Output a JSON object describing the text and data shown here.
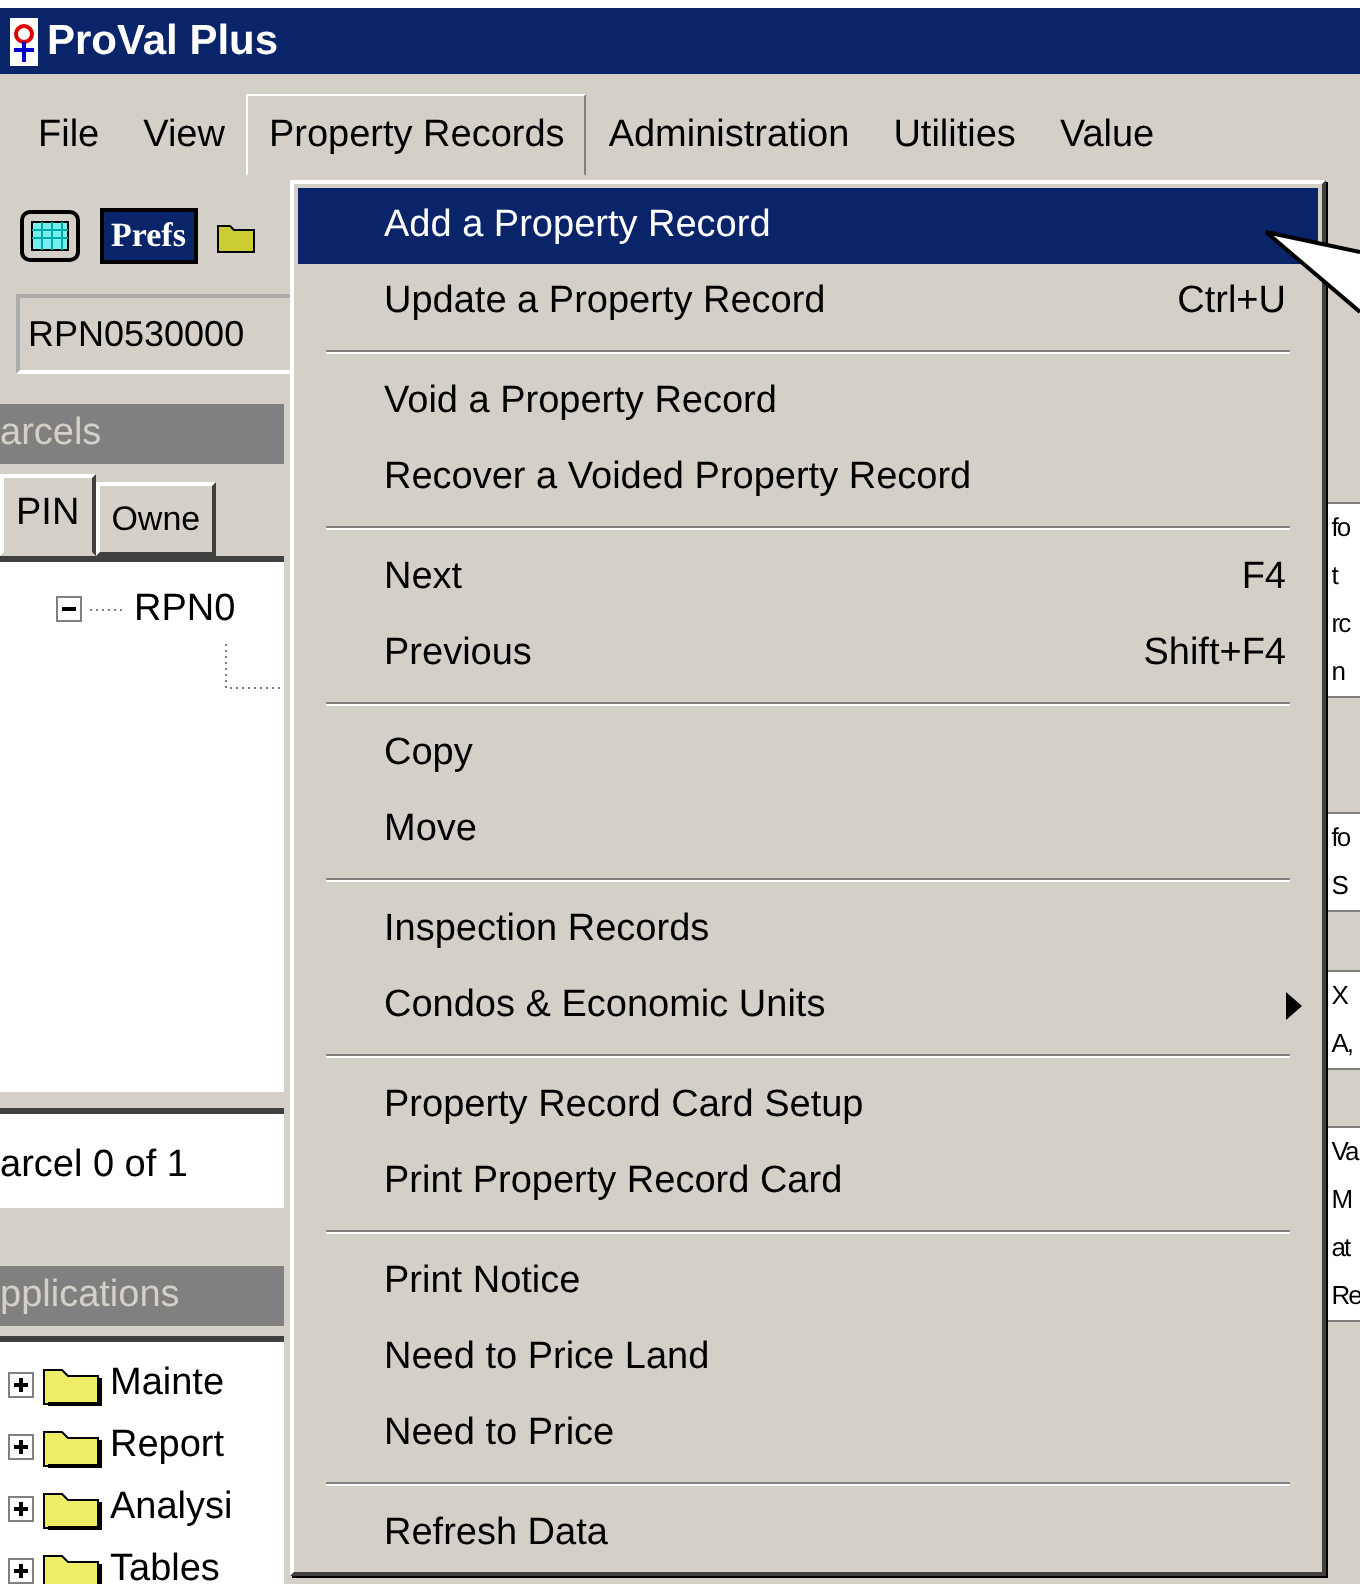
{
  "window": {
    "title": "ProVal Plus"
  },
  "menu_bar": [
    {
      "label": "File",
      "selected": false
    },
    {
      "label": "View",
      "selected": false
    },
    {
      "label": "Property Records",
      "selected": true
    },
    {
      "label": "Administration",
      "selected": false
    },
    {
      "label": "Utilities",
      "selected": false
    },
    {
      "label": "Value",
      "selected": false
    }
  ],
  "toolbar": {
    "prefs_button": {
      "label": "Prefs",
      "selected": true
    }
  },
  "pin_field": {
    "value": "RPN0530000"
  },
  "parcels_panel": {
    "title": "arcels",
    "tabs": [
      {
        "label": "PIN",
        "selected": true
      },
      {
        "label": "Owne",
        "selected": false
      }
    ],
    "tree": [
      {
        "label": "RPN0",
        "expanded": true
      }
    ],
    "status": "arcel 0 of 1"
  },
  "applications_panel": {
    "title": "pplications",
    "tree": [
      {
        "label": "Mainte",
        "expanded": false
      },
      {
        "label": "Report",
        "expanded": false
      },
      {
        "label": "Analysi",
        "expanded": false
      },
      {
        "label": "Tables",
        "expanded": false
      }
    ]
  },
  "right_panel": {
    "groups": [
      {
        "lines": [
          "fo",
          "t",
          "rc",
          "n"
        ]
      },
      {
        "lines": [
          "fo",
          "S"
        ]
      },
      {
        "lines": [
          "X",
          "A,"
        ]
      },
      {
        "lines": [
          "Va",
          "M",
          "at",
          "Re"
        ]
      }
    ]
  },
  "dropdown": {
    "items": [
      {
        "kind": "item",
        "label": "Add a Property Record",
        "selected": true
      },
      {
        "kind": "item",
        "label": "Update a Property Record",
        "shortcut": "Ctrl+U",
        "selected": false
      },
      {
        "kind": "separator"
      },
      {
        "kind": "item",
        "label": "Void a Property Record",
        "selected": false
      },
      {
        "kind": "item",
        "label": "Recover a Voided Property Record",
        "selected": false
      },
      {
        "kind": "separator"
      },
      {
        "kind": "item",
        "label": "Next",
        "shortcut": "F4",
        "selected": false
      },
      {
        "kind": "item",
        "label": "Previous",
        "shortcut": "Shift+F4",
        "selected": false
      },
      {
        "kind": "separator"
      },
      {
        "kind": "item",
        "label": "Copy",
        "selected": false
      },
      {
        "kind": "item",
        "label": "Move",
        "selected": false
      },
      {
        "kind": "separator"
      },
      {
        "kind": "item",
        "label": "Inspection Records",
        "selected": false
      },
      {
        "kind": "item",
        "label": "Condos & Economic Units",
        "submenu": true,
        "selected": false
      },
      {
        "kind": "separator"
      },
      {
        "kind": "item",
        "label": "Property Record Card Setup",
        "selected": false
      },
      {
        "kind": "item",
        "label": "Print Property Record Card",
        "selected": false
      },
      {
        "kind": "separator"
      },
      {
        "kind": "item",
        "label": "Print Notice",
        "selected": false
      },
      {
        "kind": "item",
        "label": "Need to Price Land",
        "selected": false
      },
      {
        "kind": "item",
        "label": "Need to Price",
        "selected": false
      },
      {
        "kind": "separator"
      },
      {
        "kind": "item",
        "label": "Refresh Data",
        "selected": false
      }
    ]
  }
}
